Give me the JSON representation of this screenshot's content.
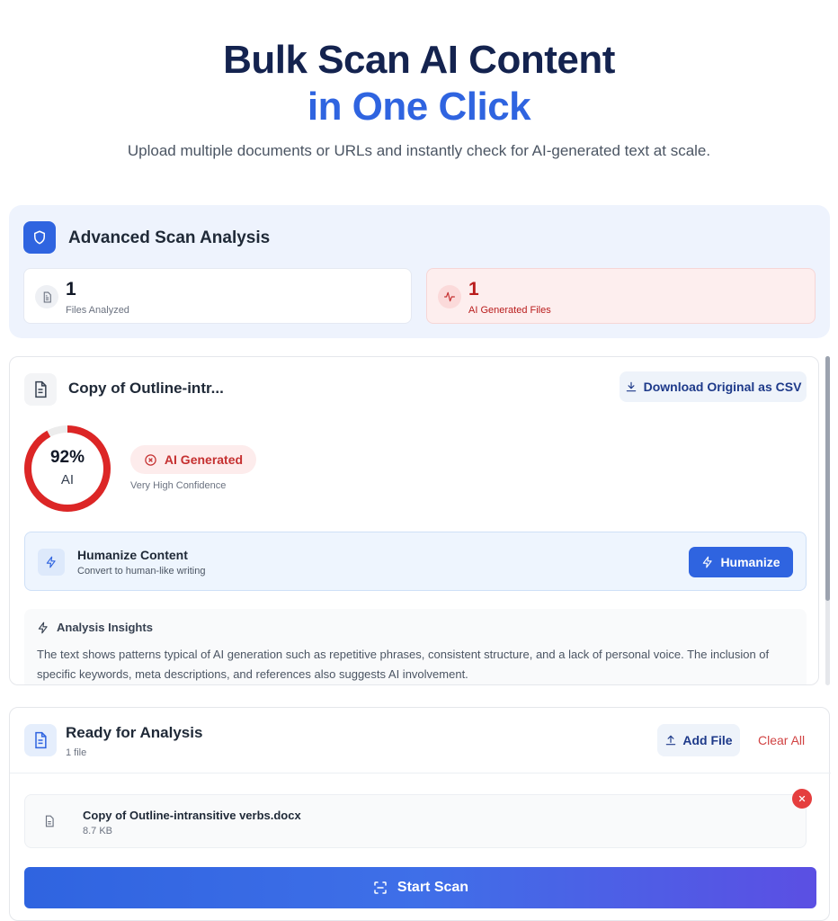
{
  "hero": {
    "title_line1": "Bulk Scan AI Content",
    "title_line2": "in One Click",
    "subtitle": "Upload multiple documents or URLs and instantly check for AI-generated text at scale."
  },
  "advanced": {
    "title": "Advanced Scan Analysis",
    "files_analyzed": {
      "value": "1",
      "label": "Files Analyzed"
    },
    "ai_generated": {
      "value": "1",
      "label": "AI Generated Files"
    }
  },
  "result": {
    "doc_title": "Copy of Outline-intr...",
    "download_label": "Download Original as CSV",
    "score_percent": 92,
    "score_text": "92%",
    "score_label": "AI",
    "verdict": "AI Generated",
    "confidence": "Very High Confidence",
    "humanize": {
      "title": "Humanize Content",
      "subtitle": "Convert to human-like writing",
      "button": "Humanize"
    },
    "insights": {
      "title": "Analysis Insights",
      "text": "The text shows patterns typical of AI generation such as repetitive phrases, consistent structure, and a lack of personal voice. The inclusion of specific keywords, meta descriptions, and references also suggests AI involvement."
    }
  },
  "ready": {
    "title": "Ready for Analysis",
    "count": "1 file",
    "add_file": "Add File",
    "clear_all": "Clear All",
    "files": [
      {
        "name": "Copy of Outline-intransitive verbs.docx",
        "size": "8.7 KB"
      }
    ],
    "start_scan": "Start Scan"
  },
  "colors": {
    "brand_blue": "#2f64e0",
    "navy": "#14234f",
    "danger": "#e53e3e"
  },
  "icons": {
    "shield": "shield-icon",
    "document": "document-icon",
    "activity": "activity-icon",
    "download": "download-icon",
    "x_circle": "x-circle-icon",
    "bolt": "bolt-icon",
    "upload": "upload-icon",
    "scan": "scan-icon",
    "close": "close-icon"
  }
}
